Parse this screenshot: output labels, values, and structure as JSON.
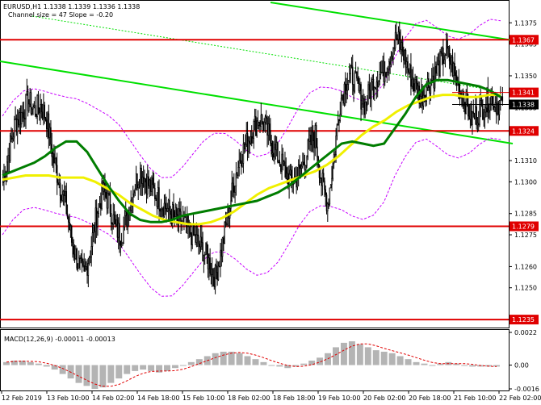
{
  "header": {
    "symbol_line": "EURUSD,H1  1.1338 1.1339 1.1336 1.1338",
    "channel_line": "Channel size = 47 Slope = -0.20"
  },
  "macd": {
    "label": "MACD(12,26,9) -0.00011 -0.00013",
    "ticks": [
      "0.0022",
      "0.00",
      "-0.0016"
    ]
  },
  "colors": {
    "candle": "#000000",
    "ma_fast": "#007d00",
    "ma_slow": "#f0f000",
    "envelope": "#c800ff",
    "level": "#e00000",
    "channel": "#00e000",
    "macd_hist": "#b4b4b4",
    "macd_signal": "#e00000"
  },
  "chart_data": {
    "type": "candlestick",
    "symbol": "EURUSD",
    "timeframe": "H1",
    "ylim": [
      1.1232,
      1.1385
    ],
    "y_ticks": [
      "1.1375",
      "1.1365",
      "1.1350",
      "1.1335",
      "1.1325",
      "1.1310",
      "1.1300",
      "1.1285",
      "1.1275",
      "1.1260",
      "1.1250",
      "1.1235"
    ],
    "x_ticks": [
      "12 Feb 2019",
      "13 Feb 10:00",
      "14 Feb 02:00",
      "14 Feb 18:00",
      "15 Feb 10:00",
      "18 Feb 02:00",
      "18 Feb 18:00",
      "19 Feb 10:00",
      "20 Feb 02:00",
      "20 Feb 18:00",
      "21 Feb 10:00",
      "22 Feb 02:00"
    ],
    "levels": [
      {
        "label": "1.1367",
        "value": 1.1367
      },
      {
        "label": "1.1324",
        "value": 1.1324
      },
      {
        "label": "1.1279",
        "value": 1.1279
      },
      {
        "label": "1.1235",
        "value": 1.1235
      }
    ],
    "current_prices": [
      {
        "label": "1.1341",
        "value": 1.1341,
        "color": "#e00000"
      },
      {
        "label": "1.1338",
        "value": 1.1338,
        "color": "#000000"
      }
    ],
    "price_path": [
      1.13,
      1.1315,
      1.1328,
      1.1332,
      1.1338,
      1.1334,
      1.1336,
      1.133,
      1.1312,
      1.13,
      1.129,
      1.1272,
      1.1262,
      1.1255,
      1.1268,
      1.1285,
      1.1296,
      1.129,
      1.1278,
      1.1275,
      1.1285,
      1.1298,
      1.1305,
      1.13,
      1.1296,
      1.1292,
      1.1288,
      1.1285,
      1.1282,
      1.128,
      1.1276,
      1.1272,
      1.1268,
      1.1262,
      1.1255,
      1.1268,
      1.1284,
      1.13,
      1.1312,
      1.1318,
      1.1325,
      1.133,
      1.1326,
      1.1318,
      1.1312,
      1.1306,
      1.13,
      1.1302,
      1.1308,
      1.1316,
      1.1322,
      1.13,
      1.129,
      1.1312,
      1.1338,
      1.1348,
      1.135,
      1.1342,
      1.1336,
      1.1345,
      1.135,
      1.1352,
      1.136,
      1.1368,
      1.1362,
      1.1352,
      1.1345,
      1.134,
      1.1346,
      1.135,
      1.1356,
      1.1362,
      1.1354,
      1.1344,
      1.1338,
      1.133,
      1.1332,
      1.1336,
      1.134,
      1.1337,
      1.1338
    ],
    "ma_fast": [
      1.1303,
      1.1305,
      1.1307,
      1.1309,
      1.1312,
      1.1316,
      1.1319,
      1.1319,
      1.1314,
      1.1306,
      1.1298,
      1.1291,
      1.1285,
      1.1282,
      1.1281,
      1.1281,
      1.1282,
      1.1284,
      1.1285,
      1.1286,
      1.1287,
      1.1288,
      1.1289,
      1.129,
      1.1291,
      1.1293,
      1.1295,
      1.1298,
      1.1302,
      1.1306,
      1.131,
      1.1314,
      1.1318,
      1.1319,
      1.1318,
      1.1317,
      1.1318,
      1.1325,
      1.1332,
      1.134,
      1.1346,
      1.1348,
      1.1348,
      1.1347,
      1.1346,
      1.1345,
      1.1343,
      1.134
    ],
    "ma_slow": [
      1.1301,
      1.1302,
      1.1303,
      1.1303,
      1.1303,
      1.1302,
      1.1302,
      1.1302,
      1.13,
      1.1297,
      1.1294,
      1.129,
      1.1287,
      1.1284,
      1.1282,
      1.1281,
      1.128,
      1.128,
      1.1281,
      1.1283,
      1.1286,
      1.129,
      1.1294,
      1.1297,
      1.1299,
      1.1301,
      1.1303,
      1.1305,
      1.1308,
      1.1312,
      1.1317,
      1.1322,
      1.1326,
      1.1329,
      1.1333,
      1.1336,
      1.1338,
      1.134,
      1.1341,
      1.1341,
      1.134,
      1.134,
      1.1341,
      1.1341
    ],
    "macd_hist": [
      0.0002,
      0.0003,
      0.0003,
      0.0002,
      0.0001,
      -0.0001,
      -0.0003,
      -0.0006,
      -0.0009,
      -0.0012,
      -0.0014,
      -0.0016,
      -0.0015,
      -0.0012,
      -0.0009,
      -0.0006,
      -0.0004,
      -0.0003,
      -0.0004,
      -0.0005,
      -0.0004,
      -0.0002,
      0.0,
      0.0002,
      0.0004,
      0.0006,
      0.0008,
      0.0009,
      0.0009,
      0.0008,
      0.0006,
      0.0004,
      0.0002,
      0.0,
      -0.0001,
      -0.0002,
      -0.0001,
      0.0001,
      0.0003,
      0.0005,
      0.0008,
      0.0012,
      0.0015,
      0.0016,
      0.0014,
      0.0012,
      0.001,
      0.0009,
      0.0008,
      0.0006,
      0.0004,
      0.0002,
      0.0001,
      0.0,
      0.0001,
      0.0002,
      0.0001,
      0.0,
      -0.0001,
      -0.0001,
      -0.0001,
      -0.0001
    ]
  }
}
